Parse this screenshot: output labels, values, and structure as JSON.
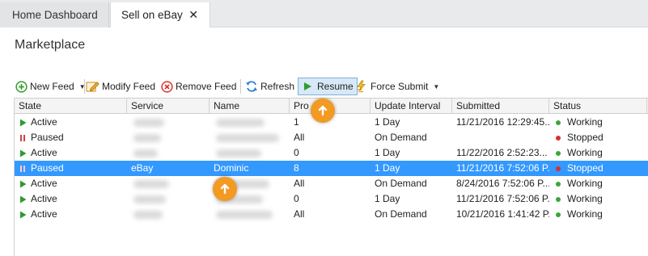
{
  "tabs": [
    {
      "label": "Home Dashboard"
    },
    {
      "label": "Sell on eBay",
      "close": "✕"
    }
  ],
  "page_title": "Marketplace",
  "toolbar": {
    "new_feed": "New Feed",
    "modify_feed": "Modify Feed",
    "remove_feed": "Remove Feed",
    "refresh": "Refresh",
    "resume": "Resume",
    "force_submit": "Force Submit"
  },
  "grid": {
    "columns": [
      "State",
      "Service",
      "Name",
      "Products",
      "Update Interval",
      "Submitted",
      "Status"
    ],
    "header_products_visible": "Pro",
    "rows": [
      {
        "state": "Active",
        "service": "",
        "name": "",
        "products": "1",
        "interval": "1 Day",
        "submitted": "11/21/2016  12:29:45...",
        "status": "Working"
      },
      {
        "state": "Paused",
        "service": "",
        "name": "",
        "products": "All",
        "interval": "On Demand",
        "submitted": "",
        "status": "Stopped"
      },
      {
        "state": "Active",
        "service": "",
        "name": "",
        "products": "0",
        "interval": "1 Day",
        "submitted": "11/22/2016  2:52:23...",
        "status": "Working"
      },
      {
        "state": "Paused",
        "service": "eBay",
        "name": "Dominic",
        "products": "8",
        "interval": "1 Day",
        "submitted": "11/21/2016  7:52:06  P...",
        "status": "Stopped"
      },
      {
        "state": "Active",
        "service": "",
        "name": "",
        "products": "All",
        "interval": "On Demand",
        "submitted": "8/24/2016  7:52:06  P...",
        "status": "Working"
      },
      {
        "state": "Active",
        "service": "",
        "name": "",
        "products": "0",
        "interval": "1 Day",
        "submitted": "11/21/2016  7:52:06  P...",
        "status": "Working"
      },
      {
        "state": "Active",
        "service": "",
        "name": "",
        "products": "All",
        "interval": "On Demand",
        "submitted": "10/21/2016  1:41:42  P...",
        "status": "Working"
      }
    ]
  },
  "colors": {
    "selected_row": "#3399ff",
    "working_dot": "#3aa63a",
    "stopped_dot": "#d63030",
    "callout": "#f39a23"
  },
  "icons": {
    "new_feed": "plus-circle-icon",
    "modify_feed": "pencil-icon",
    "remove_feed": "x-circle-icon",
    "refresh": "refresh-icon",
    "resume": "play-icon",
    "force_submit": "lightning-icon",
    "active_state": "play-icon",
    "paused_state": "pause-icon",
    "callout": "arrow-up-icon"
  }
}
